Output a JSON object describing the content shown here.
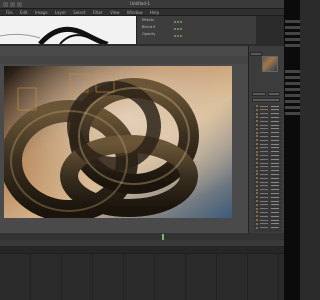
{
  "app": {
    "title": "Untitled-1",
    "accent": "#6fbf5f"
  },
  "menu": {
    "items": [
      "File",
      "Edit",
      "Image",
      "Layer",
      "Select",
      "Filter",
      "View",
      "Window",
      "Help"
    ]
  },
  "properties": {
    "rows": [
      {
        "label": "Effects"
      },
      {
        "label": "Blend If"
      },
      {
        "label": "Opacity"
      }
    ]
  },
  "right_panel": {
    "list_count": 33
  },
  "icons": [
    "minimize-icon",
    "maximize-icon",
    "close-icon",
    "timeline-playhead-icon"
  ],
  "colors": {
    "bg": "#2b2b2b",
    "panel": "#3c3c3c",
    "keyframe": "#6fbf5f"
  }
}
